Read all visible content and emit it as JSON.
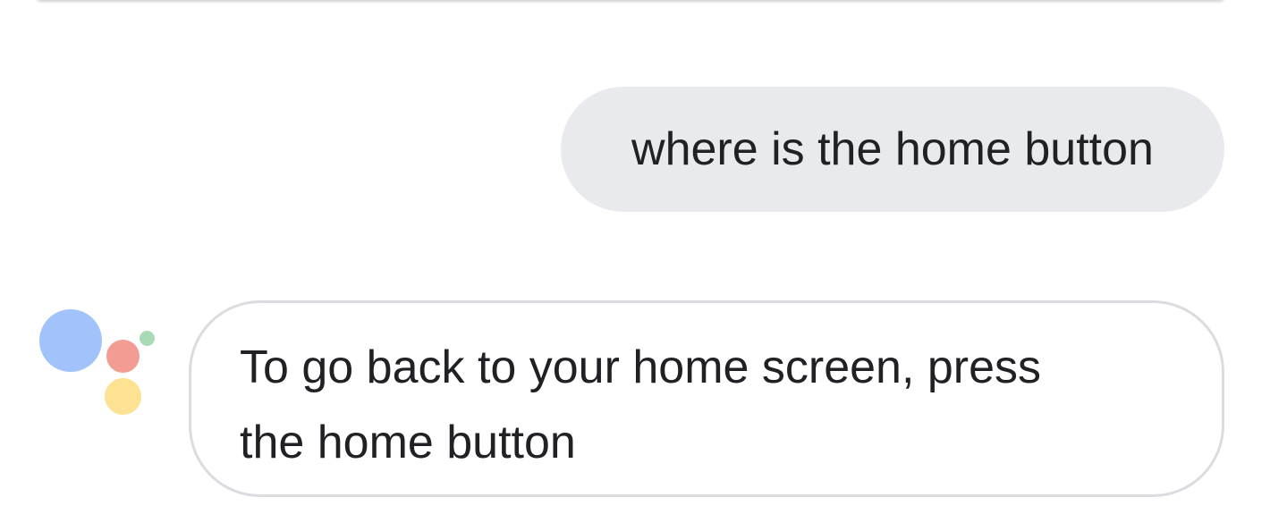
{
  "conversation": {
    "user_query": "where is the home button",
    "assistant_reply": "To go back to your home screen, press the home button"
  },
  "colors": {
    "user_bubble_bg": "#e8eaed",
    "assistant_bubble_border": "#dadce0",
    "text": "#202124",
    "logo_blue": "#a1c2fa",
    "logo_red": "#f29c94",
    "logo_yellow": "#fde293",
    "logo_green": "#a8dab5"
  },
  "icons": {
    "assistant_logo": "google-assistant-dots-icon"
  }
}
